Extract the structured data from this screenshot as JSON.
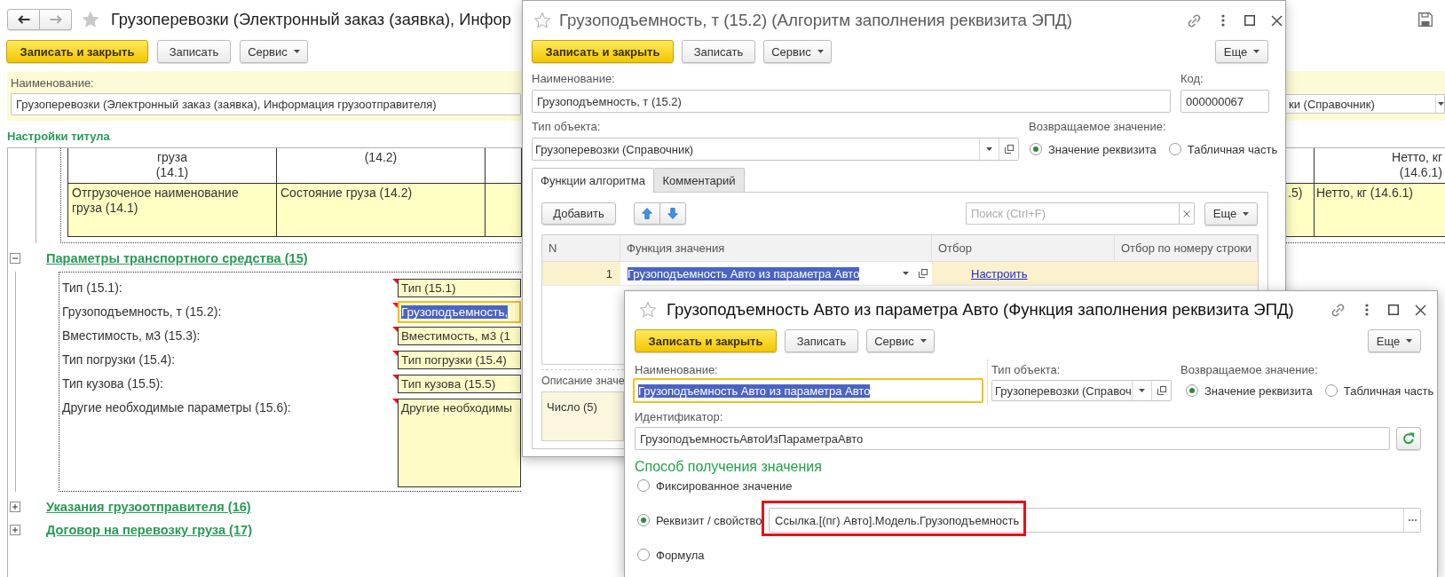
{
  "main_window": {
    "nav": [
      {
        "kind": "back",
        "disabled": false
      },
      {
        "kind": "forward",
        "disabled": true
      }
    ],
    "title": "Грузоперевозки (Электронный заказ (заявка), Инфор",
    "toolbar": [
      {
        "kind": "primary",
        "label": "Записать и закрыть"
      },
      {
        "kind": "plain",
        "label": "Записать"
      },
      {
        "kind": "menu",
        "label": "Сервис"
      }
    ],
    "name_field": {
      "label": "Наименование:",
      "value": "Грузоперевозки (Электронный заказ (заявка), Информация грузоотправителя)"
    },
    "object_type_field": {
      "value": "ки (Справочник)"
    },
    "section_title": "Настройки титула",
    "cargo_table": {
      "columns": [
        "груза\n(14.1)",
        "(14.2)"
      ],
      "rows": [
        [
          "Отгрузоченое наименование груза (14.1)",
          "Состояние груза (14.2)"
        ]
      ],
      "right_columns": [
        "Нетто, кг\n(14.6.1)"
      ],
      "right_rows": [
        [
          ".5)",
          "Нетто, кг (14.6.1)"
        ]
      ]
    },
    "groups": [
      {
        "title": "Параметры транспортного средства (15)",
        "expanded": true,
        "fields": [
          {
            "kind": "line",
            "label": "Тип (15.1):",
            "value": "Тип (15.1)",
            "focused": false
          },
          {
            "kind": "line",
            "label": "Грузоподъемность, т (15.2):",
            "value": "Грузоподъемность,",
            "focused": true
          },
          {
            "kind": "line",
            "label": "Вместимость, м3 (15.3):",
            "value": "Вместимость, м3 (1",
            "focused": false
          },
          {
            "kind": "line",
            "label": "Тип погрузки (15.4):",
            "value": "Тип погрузки (15.4)",
            "focused": false
          },
          {
            "kind": "line",
            "label": "Тип кузова (15.5):",
            "value": "Тип кузова (15.5)",
            "focused": false
          },
          {
            "kind": "area",
            "label": "Другие необходимые параметры (15.6):",
            "value": "Другие необходимы",
            "focused": false
          }
        ]
      },
      {
        "title": "Указания грузоотправителя (16)",
        "expanded": false
      },
      {
        "title": "Договор на перевозку груза (17)",
        "expanded": false
      }
    ]
  },
  "algorithm_window": {
    "title": "Грузоподъемность, т (15.2) (Алгоритм заполнения реквизита ЭПД)",
    "active": false,
    "toolbar": [
      {
        "kind": "primary",
        "label": "Записать и закрыть"
      },
      {
        "kind": "plain",
        "label": "Записать"
      },
      {
        "kind": "menu",
        "label": "Сервис"
      }
    ],
    "more_button": "Еще",
    "name_field": {
      "label": "Наименование:",
      "value": "Грузоподъемность, т (15.2)"
    },
    "code_field": {
      "label": "Код:",
      "value": "000000067"
    },
    "object_type_field": {
      "label": "Тип объекта:",
      "value": "Грузоперевозки (Справочник)"
    },
    "return_value": {
      "label": "Возвращаемое значение:",
      "options": [
        {
          "label": "Значение реквизита",
          "selected": true
        },
        {
          "label": "Табличная часть",
          "selected": false
        }
      ]
    },
    "tabs": [
      {
        "label": "Функции алгоритма",
        "selected": true
      },
      {
        "label": "Комментарий",
        "selected": false
      }
    ],
    "add_button": "Добавить",
    "search": {
      "placeholder": "Поиск (Ctrl+F)"
    },
    "table_more_button": "Еще",
    "table": {
      "columns": [
        "N",
        "Функция значения",
        "Отбор",
        "Отбор по номеру строки"
      ],
      "rows": [
        {
          "n": "1",
          "function": "Грузоподъемность Авто из параметра Авто",
          "filter": "Настроить",
          "selected": true
        }
      ]
    },
    "description": {
      "label": "Описание значе",
      "value": "Число (5)"
    }
  },
  "function_window": {
    "title": "Грузоподъемность Авто из параметра Авто (Функция заполнения реквизита ЭПД)",
    "active": true,
    "toolbar": [
      {
        "kind": "primary",
        "label": "Записать и закрыть"
      },
      {
        "kind": "plain",
        "label": "Записать"
      },
      {
        "kind": "menu",
        "label": "Сервис"
      }
    ],
    "more_button": "Еще",
    "name_field": {
      "label": "Наименование:",
      "value": "Грузоподъемность Авто из параметра Авто",
      "focused": true
    },
    "object_type_field": {
      "label": "Тип объекта:",
      "value": "Грузоперевозки (Справоч"
    },
    "return_value": {
      "label": "Возвращаемое значение:",
      "options": [
        {
          "label": "Значение реквизита",
          "selected": true
        },
        {
          "label": "Табличная часть",
          "selected": false
        }
      ]
    },
    "identifier_field": {
      "label": "Идентификатор:",
      "value": "ГрузоподъемностьАвтоИзПараметраАвто"
    },
    "method": {
      "title": "Способ получения значения",
      "options": [
        {
          "label": "Фиксированное значение",
          "selected": false,
          "highlighted": false
        },
        {
          "label": "Реквизит / свойство",
          "selected": true,
          "value": "Ссылка.[(пг) Авто].Модель.Грузоподъемность",
          "highlighted": true
        },
        {
          "label": "Формула",
          "selected": false,
          "highlighted": false
        }
      ]
    }
  }
}
